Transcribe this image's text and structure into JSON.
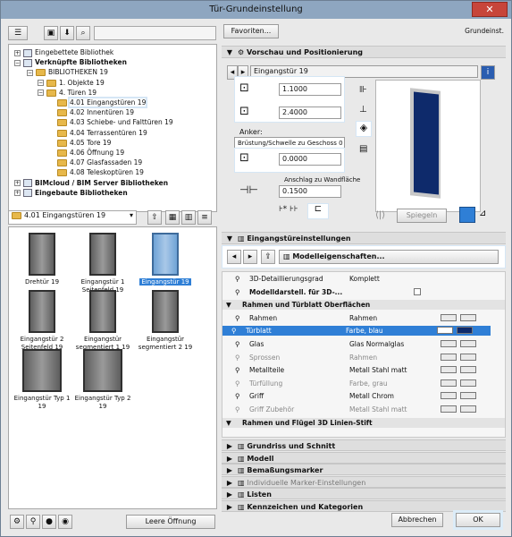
{
  "window": {
    "title": "Tür-Grundeinstellung",
    "close": "✕"
  },
  "header": {
    "favorites": "Favoriten...",
    "default": "Grundeinst."
  },
  "tree": [
    {
      "label": "Eingebettete Bibliothek",
      "type": "lib"
    },
    {
      "label": "Verknüpfte Bibliotheken",
      "type": "lib",
      "bold": true
    },
    {
      "label": "BIBLIOTHEKEN 19",
      "type": "folder"
    },
    {
      "label": "1. Objekte 19",
      "type": "folder"
    },
    {
      "label": "4. Türen 19",
      "type": "folder"
    },
    {
      "label": "4.01 Eingangstüren 19",
      "type": "folder",
      "selected": true
    },
    {
      "label": "4.02 Innentüren 19",
      "type": "folder"
    },
    {
      "label": "4.03 Schiebe- und Falttüren 19",
      "type": "folder"
    },
    {
      "label": "4.04 Terrassentüren 19",
      "type": "folder"
    },
    {
      "label": "4.05 Tore 19",
      "type": "folder"
    },
    {
      "label": "4.06 Öffnung 19",
      "type": "folder"
    },
    {
      "label": "4.07 Glasfassaden 19",
      "type": "folder"
    },
    {
      "label": "4.08 Teleskoptüren 19",
      "type": "folder"
    },
    {
      "label": "BIMcloud / BIM Server Bibliotheken",
      "type": "lib",
      "bold": true
    },
    {
      "label": "Eingebaute Bibliotheken",
      "type": "lib",
      "bold": true
    }
  ],
  "folder_select": "4.01 Eingangstüren 19",
  "thumbs": [
    {
      "label": "Drehtür 19"
    },
    {
      "label": "Eingangstür 1 Seitenfeld 19"
    },
    {
      "label": "Eingangstür 19",
      "selected": true
    },
    {
      "label": "Eingangstür 2 Seitenfeld 19"
    },
    {
      "label": "Eingangstür segmentiert 1 19"
    },
    {
      "label": "Eingangstür segmentiert 2 19"
    },
    {
      "label": "Eingangstür Typ 1 19"
    },
    {
      "label": "Eingangstür Typ 2 19"
    }
  ],
  "leere_oeffnung": "Leere Öffnung",
  "preview": {
    "section": "Vorschau und Positionierung",
    "name": "Eingangstür 19",
    "width": "1.1000",
    "height": "2.4000",
    "anker_label": "Anker:",
    "anker_value": "Brüstung/Schwelle zu Geschoss 0",
    "anker_num": "0.0000",
    "anschlag_label": "Anschlag zu Wandfläche",
    "anschlag_value": "0.1500",
    "spiegeln": "Spiegeln",
    "door_color": "#0e2a6b"
  },
  "settings": {
    "section": "Eingangstüreinstellungen",
    "modell_btn": "Modelleigenschaften...",
    "rows": [
      {
        "a": "3D-Detaillierungsgrad",
        "b": "Komplett"
      },
      {
        "a": "Modelldarstell. für 3D-...",
        "b": "",
        "bold": true
      },
      {
        "a": "Rahmen und Türblatt Oberflächen",
        "b": "",
        "header": true
      },
      {
        "a": "Rahmen",
        "b": "Rahmen"
      },
      {
        "a": "Türblatt",
        "b": "Farbe, blau",
        "selected": true
      },
      {
        "a": "Glas",
        "b": "Glas Normalglas"
      },
      {
        "a": "Sprossen",
        "b": "Rahmen",
        "grey": true
      },
      {
        "a": "Metallteile",
        "b": "Metall Stahl matt"
      },
      {
        "a": "Türfüllung",
        "b": "Farbe, grau",
        "grey": true
      },
      {
        "a": "Griff",
        "b": "Metall Chrom"
      },
      {
        "a": "Griff Zubehör",
        "b": "Metall Stahl matt",
        "grey": true
      },
      {
        "a": "Rahmen und Flügel 3D Linien-Stift",
        "b": "",
        "header": true
      }
    ]
  },
  "bottom_sections": [
    "Grundriss und Schnitt",
    "Modell",
    "Bemaßungsmarker",
    "Individuelle Marker-Einstellungen",
    "Listen",
    "Kennzeichen und Kategorien"
  ],
  "buttons": {
    "cancel": "Abbrechen",
    "ok": "OK"
  },
  "colors": {
    "selection": "#2f7fd6",
    "door_blue": "#0e2a6b"
  }
}
